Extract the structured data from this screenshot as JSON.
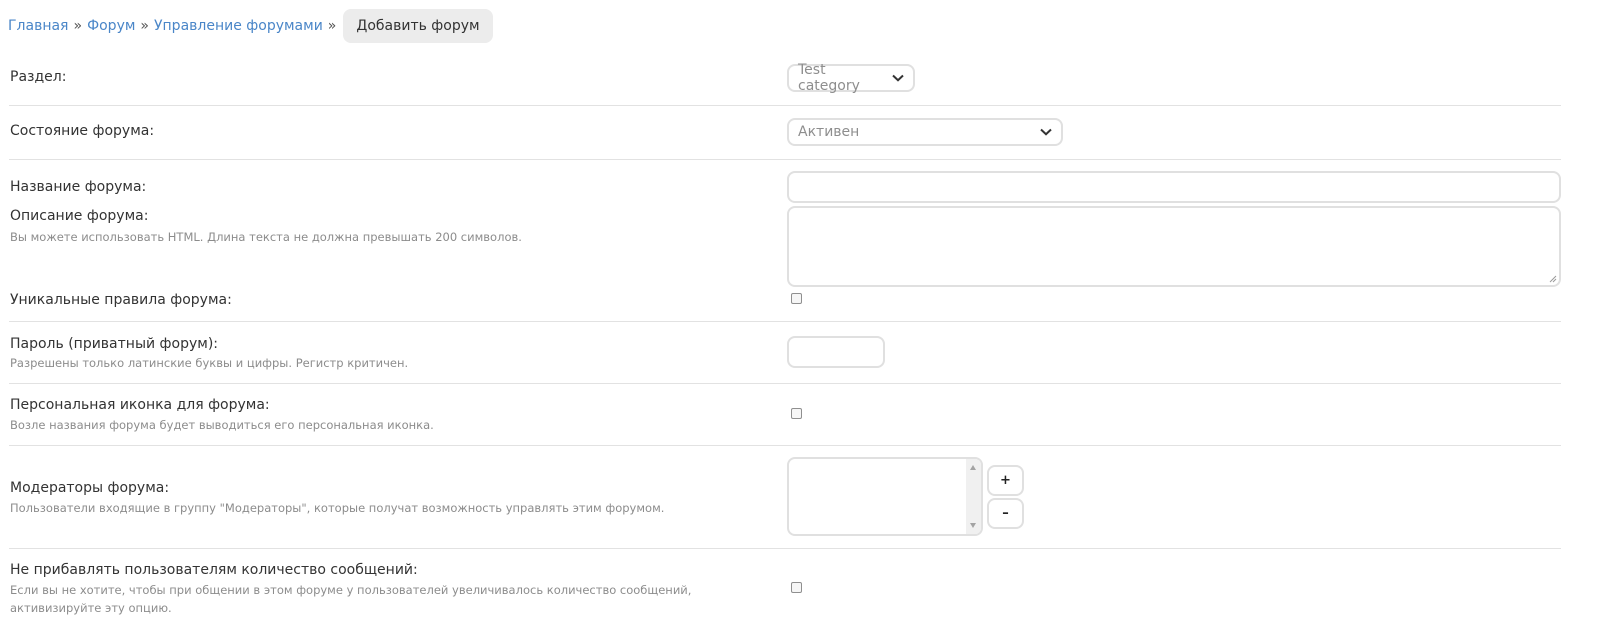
{
  "breadcrumb": {
    "items": [
      "Главная",
      "Форум",
      "Управление форумами"
    ],
    "separator": "»",
    "current": "Добавить форум"
  },
  "fields": {
    "section": {
      "label": "Раздел:",
      "value": "Test category"
    },
    "state": {
      "label": "Состояние форума:",
      "value": "Активен"
    },
    "name": {
      "label": "Название форума:",
      "value": ""
    },
    "description": {
      "label": "Описание форума:",
      "hint": "Вы можете использовать HTML. Длина текста не должна превышать 200 символов.",
      "value": ""
    },
    "unique_rules": {
      "label": "Уникальные правила форума:",
      "checked": false
    },
    "password": {
      "label": "Пароль (приватный форум):",
      "hint": "Разрешены только латинские буквы и цифры. Регистр критичен.",
      "value": ""
    },
    "custom_icon": {
      "label": "Персональная иконка для форума:",
      "hint": "Возле названия форума будет выводиться его персональная иконка.",
      "checked": false
    },
    "moderators": {
      "label": "Модераторы форума:",
      "hint": "Пользователи входящие в группу \"Модераторы\", которые получат возможность управлять этим форумом.",
      "add_label": "+",
      "remove_label": "–",
      "items": []
    },
    "no_post_count": {
      "label": "Не прибавлять пользователям количество сообщений:",
      "hint_line1": "Если вы не хотите, чтобы при общении в этом форуме у пользователей увеличивалось количество сообщений,",
      "hint_line2": "активизируйте эту опцию.",
      "checked": false
    }
  },
  "colors": {
    "link": "#4a86c8",
    "hint": "#8c8c8c",
    "border": "#e0e0e0",
    "divider": "#e2e2e2"
  },
  "icons": {
    "dropdown": "chevron-down-icon",
    "resize": "resize-grip-icon"
  }
}
